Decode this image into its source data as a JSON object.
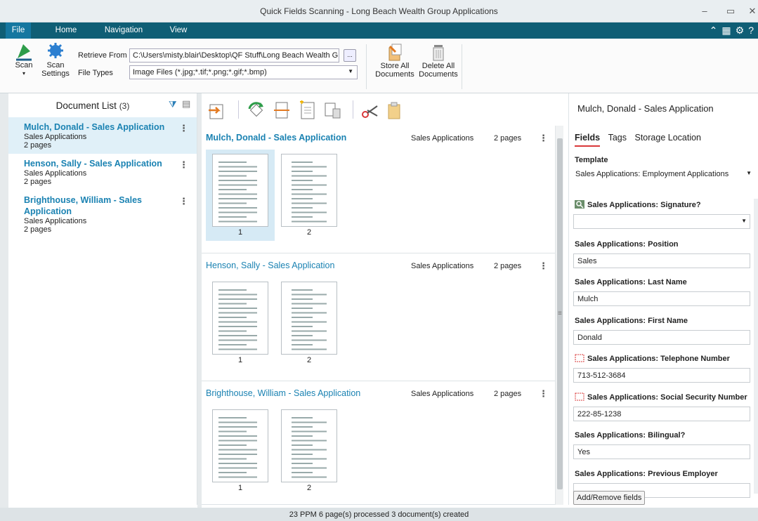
{
  "window": {
    "title": "Quick Fields Scanning - Long Beach Wealth Group Applications",
    "minimize": "–",
    "maximize": "▭",
    "close": "✕"
  },
  "tabs": [
    "File",
    "Home",
    "Navigation",
    "View"
  ],
  "ribbon": {
    "scan_label": "Scan",
    "scan_settings_label_1": "Scan",
    "scan_settings_label_2": "Settings",
    "retrieve_from_label": "Retrieve From",
    "retrieve_from_value": "C:\\Users\\misty.blair\\Desktop\\QF Stuff\\Long Beach Wealth Gr",
    "browse_label": "...",
    "file_types_label": "File Types",
    "file_types_value": "Image Files (*.jpg;*.tif;*.png;*.gif;*.bmp)",
    "store_all_1": "Store All",
    "store_all_2": "Documents",
    "delete_all_1": "Delete All",
    "delete_all_2": "Documents"
  },
  "document_list": {
    "header": "Document List",
    "count": "(3)",
    "items": [
      {
        "name": "Mulch, Donald - Sales Application",
        "category": "Sales Applications",
        "pages": "2 pages"
      },
      {
        "name": "Henson, Sally - Sales Application",
        "category": "Sales Applications",
        "pages": "2 pages"
      },
      {
        "name": "Brighthouse, William - Sales Application",
        "category": "Sales Applications",
        "pages": "2 pages"
      }
    ]
  },
  "documents": [
    {
      "title": "Mulch, Donald - Sales Application",
      "category": "Sales Applications",
      "pages": "2 pages",
      "page_nums": [
        "1",
        "2"
      ]
    },
    {
      "title": "Henson, Sally - Sales Application",
      "category": "Sales Applications",
      "pages": "2 pages",
      "page_nums": [
        "1",
        "2"
      ]
    },
    {
      "title": "Brighthouse, William - Sales Application",
      "category": "Sales Applications",
      "pages": "2 pages",
      "page_nums": [
        "1",
        "2"
      ]
    }
  ],
  "metadata": {
    "title": "Mulch, Donald - Sales Application",
    "tabs": [
      "Fields",
      "Tags",
      "Storage Location"
    ],
    "template_label": "Template",
    "template_value": "Sales Applications: Employment Applications",
    "fields": [
      {
        "label": "Sales Applications: Signature?",
        "value": ""
      },
      {
        "label": "Sales Applications: Position",
        "value": "Sales"
      },
      {
        "label": "Sales Applications: Last Name",
        "value": "Mulch"
      },
      {
        "label": "Sales Applications: First Name",
        "value": "Donald"
      },
      {
        "label": "Sales Applications: Telephone Number",
        "value": "713-512-3684"
      },
      {
        "label": "Sales Applications: Social Security Number",
        "value": "222-85-1238"
      },
      {
        "label": "Sales Applications: Bilingual?",
        "value": "Yes"
      },
      {
        "label": "Sales Applications: Previous Employer",
        "value": ""
      }
    ],
    "add_remove_label": "Add/Remove fields"
  },
  "status": {
    "text": "23 PPM   6 page(s) processed   3 document(s) created"
  },
  "colors": {
    "ribbon_tab_bg": "#0f5e75",
    "link_blue": "#1a82b2",
    "selection": "#e0f0f8",
    "active_tab_underline": "#d9383a"
  }
}
